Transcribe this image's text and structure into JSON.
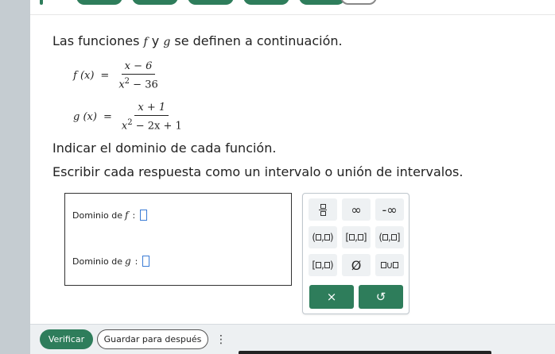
{
  "problem": {
    "intro_prefix": "Las funciones ",
    "f_symbol": "f",
    "and_word": " y ",
    "g_symbol": "g",
    "intro_suffix": " se definen a continuación.",
    "f_def": {
      "lhs": "f (x)",
      "eq": "=",
      "numerator": "x − 6",
      "den_base": "x",
      "den_exp": "2",
      "den_rest": " − 36"
    },
    "g_def": {
      "lhs": "g (x)",
      "eq": "=",
      "numerator": "x + 1",
      "den_base": "x",
      "den_exp": "2",
      "den_rest": " − 2x + 1"
    },
    "instruction_1": "Indicar el dominio de cada función.",
    "instruction_2": "Escribir cada respuesta como un intervalo o unión de intervalos."
  },
  "answers": {
    "f_label": "Dominio de",
    "f_fn": "f",
    "f_colon": ":",
    "g_label": "Dominio de",
    "g_fn": "g",
    "g_colon": ":"
  },
  "keypad": {
    "infinity": "∞",
    "neg_infinity": "-∞",
    "empty_set": "Ø",
    "union": "∪",
    "clear": "×",
    "undo": "↺"
  },
  "footer": {
    "verify_label": "Verificar",
    "save_label": "Guardar para después",
    "more_label": "⋮"
  },
  "colors": {
    "accent_green": "#2e7d5b",
    "input_border": "#3a7bd5"
  }
}
